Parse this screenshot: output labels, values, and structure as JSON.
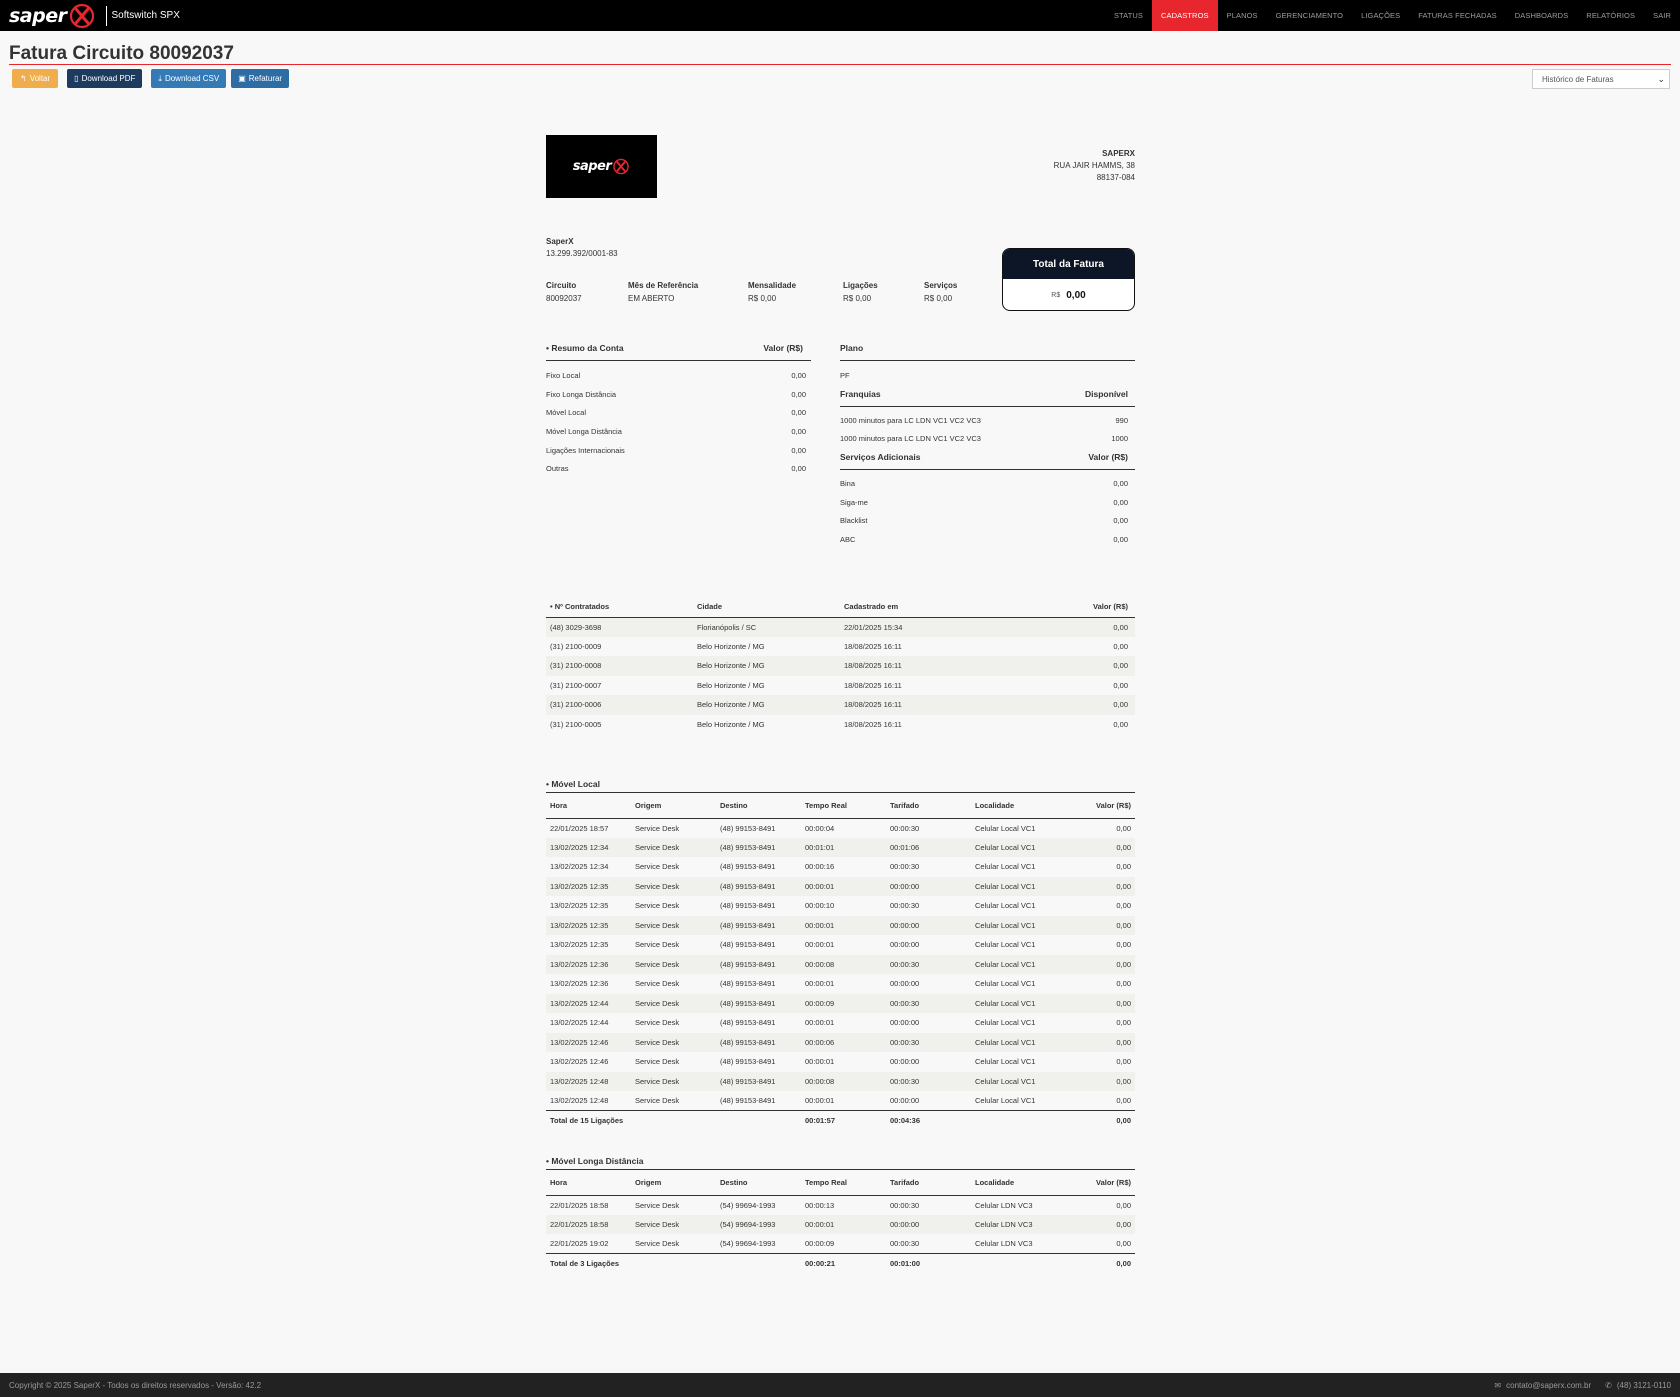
{
  "navbar": {
    "brand_word": "saper",
    "brand_sub": "Softswitch SPX",
    "items": [
      "STATUS",
      "CADASTROS",
      "PLANOS",
      "GERENCIAMENTO",
      "LIGAÇÕES",
      "FATURAS FECHADAS",
      "DASHBOARDS",
      "RELATÓRIOS",
      "SAIR"
    ],
    "active": "CADASTROS",
    "accent": "#e8262d"
  },
  "page": {
    "title": "Fatura Circuito 80092037",
    "buttons": {
      "voltar": "Voltar",
      "pdf": "Download PDF",
      "csv": "Download CSV",
      "refaturar": "Refaturar"
    },
    "history_select": "Histórico de Faturas"
  },
  "invoice": {
    "logo_word": "saper",
    "company": {
      "name": "SAPERX",
      "address": "RUA JAIR HAMMS, 38",
      "cep": "88137-084"
    },
    "client": {
      "name": "SaperX",
      "cnpj": "13.299.392/0001-83"
    },
    "info": {
      "circuito_label": "Circuito",
      "circuito": "80092037",
      "mes_label": "Mês de Referência",
      "mes": "EM ABERTO",
      "mensalidade_label": "Mensalidade",
      "mensalidade": "R$ 0,00",
      "ligacoes_label": "Ligações",
      "ligacoes": "R$ 0,00",
      "servicos_label": "Serviços",
      "servicos": "R$ 0,00"
    },
    "total": {
      "title": "Total da Fatura",
      "currency": "R$",
      "value": "0,00"
    },
    "resumo": {
      "title": "• Resumo da Conta",
      "value_header": "Valor (R$)",
      "rows": [
        {
          "label": "Fixo Local",
          "value": "0,00"
        },
        {
          "label": "Fixo Longa Distância",
          "value": "0,00"
        },
        {
          "label": "Móvel Local",
          "value": "0,00"
        },
        {
          "label": "Móvel Longa Distância",
          "value": "0,00"
        },
        {
          "label": "Ligações Internacionais",
          "value": "0,00"
        },
        {
          "label": "Outras",
          "value": "0,00"
        }
      ]
    },
    "plano": {
      "title": "Plano",
      "value": "PF",
      "franquias_title": "Franquias",
      "franquias_header": "Disponível",
      "franquias": [
        {
          "label": "1000 minutos para LC LDN VC1 VC2 VC3",
          "value": "990"
        },
        {
          "label": "1000 minutos para LC LDN VC1 VC2 VC3",
          "value": "1000"
        }
      ],
      "servicos_title": "Serviços Adicionais",
      "servicos_header": "Valor (R$)",
      "servicos": [
        {
          "label": "Bina",
          "value": "0,00"
        },
        {
          "label": "Siga-me",
          "value": "0,00"
        },
        {
          "label": "Blacklist",
          "value": "0,00"
        },
        {
          "label": "ABC",
          "value": "0,00"
        }
      ]
    },
    "numeros": {
      "headers": [
        "• Nº Contratados",
        "Cidade",
        "Cadastrado em",
        "Valor (R$)"
      ],
      "rows": [
        [
          "(48) 3029-3698",
          "Florianópolis / SC",
          "22/01/2025 15:34",
          "0,00"
        ],
        [
          "(31) 2100-0009",
          "Belo Horizonte / MG",
          "18/08/2025 16:11",
          "0,00"
        ],
        [
          "(31) 2100-0008",
          "Belo Horizonte / MG",
          "18/08/2025 16:11",
          "0,00"
        ],
        [
          "(31) 2100-0007",
          "Belo Horizonte / MG",
          "18/08/2025 16:11",
          "0,00"
        ],
        [
          "(31) 2100-0006",
          "Belo Horizonte / MG",
          "18/08/2025 16:11",
          "0,00"
        ],
        [
          "(31) 2100-0005",
          "Belo Horizonte / MG",
          "18/08/2025 16:11",
          "0,00"
        ]
      ]
    },
    "call_headers": [
      "Hora",
      "Origem",
      "Destino",
      "Tempo Real",
      "Tarifado",
      "Localidade",
      "Valor (R$)"
    ],
    "movel_local": {
      "title": "• Móvel Local",
      "rows": [
        [
          "22/01/2025 18:57",
          "Service Desk",
          "(48) 99153-8491",
          "00:00:04",
          "00:00:30",
          "Celular Local VC1",
          "0,00"
        ],
        [
          "13/02/2025 12:34",
          "Service Desk",
          "(48) 99153-8491",
          "00:01:01",
          "00:01:06",
          "Celular Local VC1",
          "0,00"
        ],
        [
          "13/02/2025 12:34",
          "Service Desk",
          "(48) 99153-8491",
          "00:00:16",
          "00:00:30",
          "Celular Local VC1",
          "0,00"
        ],
        [
          "13/02/2025 12:35",
          "Service Desk",
          "(48) 99153-8491",
          "00:00:01",
          "00:00:00",
          "Celular Local VC1",
          "0,00"
        ],
        [
          "13/02/2025 12:35",
          "Service Desk",
          "(48) 99153-8491",
          "00:00:10",
          "00:00:30",
          "Celular Local VC1",
          "0,00"
        ],
        [
          "13/02/2025 12:35",
          "Service Desk",
          "(48) 99153-8491",
          "00:00:01",
          "00:00:00",
          "Celular Local VC1",
          "0,00"
        ],
        [
          "13/02/2025 12:35",
          "Service Desk",
          "(48) 99153-8491",
          "00:00:01",
          "00:00:00",
          "Celular Local VC1",
          "0,00"
        ],
        [
          "13/02/2025 12:36",
          "Service Desk",
          "(48) 99153-8491",
          "00:00:08",
          "00:00:30",
          "Celular Local VC1",
          "0,00"
        ],
        [
          "13/02/2025 12:36",
          "Service Desk",
          "(48) 99153-8491",
          "00:00:01",
          "00:00:00",
          "Celular Local VC1",
          "0,00"
        ],
        [
          "13/02/2025 12:44",
          "Service Desk",
          "(48) 99153-8491",
          "00:00:09",
          "00:00:30",
          "Celular Local VC1",
          "0,00"
        ],
        [
          "13/02/2025 12:44",
          "Service Desk",
          "(48) 99153-8491",
          "00:00:01",
          "00:00:00",
          "Celular Local VC1",
          "0,00"
        ],
        [
          "13/02/2025 12:46",
          "Service Desk",
          "(48) 99153-8491",
          "00:00:06",
          "00:00:30",
          "Celular Local VC1",
          "0,00"
        ],
        [
          "13/02/2025 12:46",
          "Service Desk",
          "(48) 99153-8491",
          "00:00:01",
          "00:00:00",
          "Celular Local VC1",
          "0,00"
        ],
        [
          "13/02/2025 12:48",
          "Service Desk",
          "(48) 99153-8491",
          "00:00:08",
          "00:00:30",
          "Celular Local VC1",
          "0,00"
        ],
        [
          "13/02/2025 12:48",
          "Service Desk",
          "(48) 99153-8491",
          "00:00:01",
          "00:00:00",
          "Celular Local VC1",
          "0,00"
        ]
      ],
      "total": {
        "label": "Total de 15 Ligações",
        "tempo": "00:01:57",
        "tarifado": "00:04:36",
        "valor": "0,00"
      }
    },
    "movel_ld": {
      "title": "• Móvel Longa Distância",
      "rows": [
        [
          "22/01/2025 18:58",
          "Service Desk",
          "(54) 99694-1993",
          "00:00:13",
          "00:00:30",
          "Celular LDN VC3",
          "0,00"
        ],
        [
          "22/01/2025 18:58",
          "Service Desk",
          "(54) 99694-1993",
          "00:00:01",
          "00:00:00",
          "Celular LDN VC3",
          "0,00"
        ],
        [
          "22/01/2025 19:02",
          "Service Desk",
          "(54) 99694-1993",
          "00:00:09",
          "00:00:30",
          "Celular LDN VC3",
          "0,00"
        ]
      ],
      "total": {
        "label": "Total de 3 Ligações",
        "tempo": "00:00:21",
        "tarifado": "00:01:00",
        "valor": "0,00"
      }
    }
  },
  "footer": {
    "copyright": "Copyright © 2025 SaperX - Todos os direitos reservados - Versão: 42.2",
    "email": "contato@saperx.com.br",
    "phone": "(48) 3121-0110"
  }
}
